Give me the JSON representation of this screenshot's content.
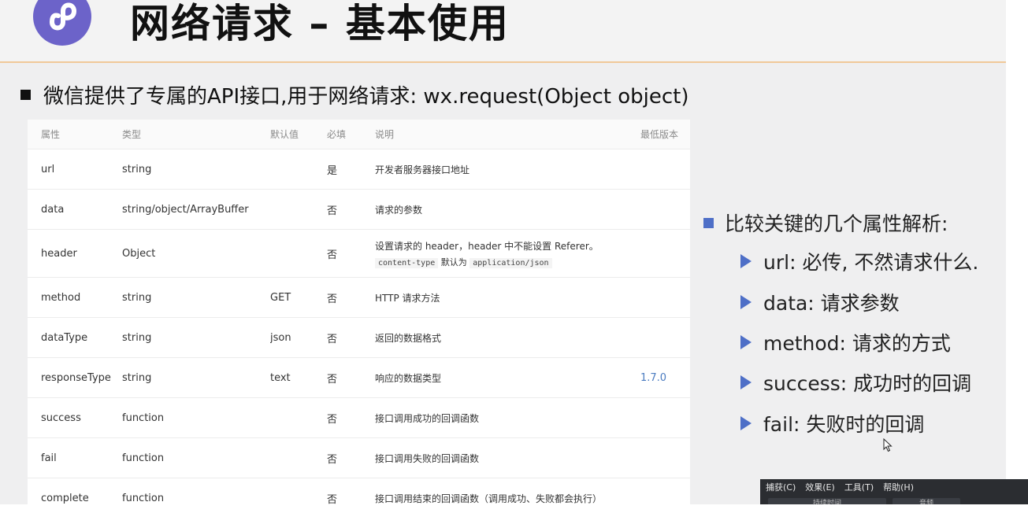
{
  "slide": {
    "title": "网络请求 – 基本使用",
    "subtitle": "微信提供了专属的API接口,用于网络请求: wx.request(Object object)",
    "logo_icon": "mini-program-logo-icon",
    "accent_color": "#6c63c9"
  },
  "table": {
    "headers": {
      "prop": "属性",
      "type": "类型",
      "default": "默认值",
      "required": "必填",
      "desc": "说明",
      "version": "最低版本"
    },
    "rows": [
      {
        "prop": "url",
        "type": "string",
        "default": "",
        "required": "是",
        "desc": "开发者服务器接口地址",
        "version": ""
      },
      {
        "prop": "data",
        "type": "string/object/ArrayBuffer",
        "default": "",
        "required": "否",
        "desc": "请求的参数",
        "version": ""
      },
      {
        "prop": "header",
        "type": "Object",
        "default": "",
        "required": "否",
        "desc": "设置请求的 header，header 中不能设置 Referer。",
        "desc_code1": "content-type",
        "desc_mid": "默认为",
        "desc_code2": "application/json",
        "version": ""
      },
      {
        "prop": "method",
        "type": "string",
        "default": "GET",
        "required": "否",
        "desc": "HTTP 请求方法",
        "version": ""
      },
      {
        "prop": "dataType",
        "type": "string",
        "default": "json",
        "required": "否",
        "desc": "返回的数据格式",
        "version": ""
      },
      {
        "prop": "responseType",
        "type": "string",
        "default": "text",
        "required": "否",
        "desc": "响应的数据类型",
        "version": "1.7.0"
      },
      {
        "prop": "success",
        "type": "function",
        "default": "",
        "required": "否",
        "desc": "接口调用成功的回调函数",
        "version": ""
      },
      {
        "prop": "fail",
        "type": "function",
        "default": "",
        "required": "否",
        "desc": "接口调用失败的回调函数",
        "version": ""
      },
      {
        "prop": "complete",
        "type": "function",
        "default": "",
        "required": "否",
        "desc": "接口调用结束的回调函数（调用成功、失败都会执行）",
        "version": ""
      }
    ]
  },
  "keys": {
    "title": "比较关键的几个属性解析:",
    "items": [
      "url: 必传, 不然请求什么.",
      "data: 请求参数",
      "method: 请求的方式",
      "success: 成功时的回调",
      "fail: 失败时的回调"
    ],
    "accent_color": "#4e6fc7"
  },
  "tool_panel": {
    "menu": [
      "捕获(C)",
      "效果(E)",
      "工具(T)",
      "帮助(H)"
    ],
    "sub_labels": [
      "持续时间",
      "音频"
    ]
  }
}
